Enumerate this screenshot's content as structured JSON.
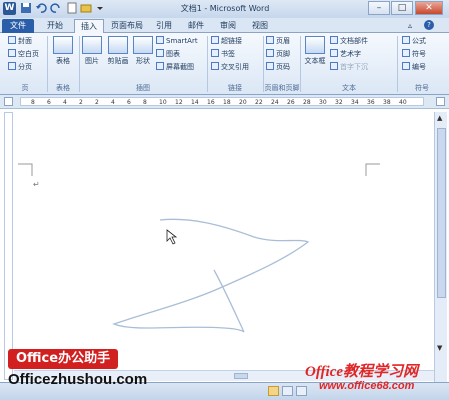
{
  "window": {
    "title": "文档1 - Microsoft Word",
    "app_icon": "W",
    "minimize": "–",
    "maximize": "□",
    "close": "✕"
  },
  "tabs": [
    {
      "label": "文件"
    },
    {
      "label": "开始"
    },
    {
      "label": "插入"
    },
    {
      "label": "页面布局"
    },
    {
      "label": "引用"
    },
    {
      "label": "邮件"
    },
    {
      "label": "审阅"
    },
    {
      "label": "视图"
    }
  ],
  "ribbon": {
    "pages": {
      "items": [
        "封面",
        "空白页",
        "分页"
      ],
      "label": "页"
    },
    "table": {
      "button": "表格",
      "label": "表格"
    },
    "illustrations": {
      "buttons": [
        "图片",
        "剪贴画",
        "形状"
      ],
      "items": [
        "SmartArt",
        "图表",
        "屏幕截图"
      ],
      "label": "插图"
    },
    "links": {
      "items": [
        "超链接",
        "书签",
        "交叉引用"
      ],
      "label": "链接"
    },
    "header_footer": {
      "items": [
        "页眉",
        "页脚",
        "页码"
      ],
      "label": "页眉和页脚"
    },
    "text": {
      "button": "文本框",
      "items": [
        "文档部件",
        "艺术字",
        "首字下沉"
      ],
      "label": "文本"
    },
    "symbols": {
      "items": [
        "公式",
        "符号",
        "编号"
      ],
      "label": "符号"
    }
  },
  "ruler": {
    "ticks": [
      "8",
      "6",
      "4",
      "2",
      "2",
      "4",
      "6",
      "8",
      "10",
      "12",
      "14",
      "16",
      "18",
      "20",
      "22",
      "24",
      "26",
      "28",
      "30",
      "32",
      "34",
      "36",
      "38",
      "40"
    ]
  },
  "document": {
    "paragraph_mark": "↵"
  },
  "watermarks": {
    "left_badge": "Office办公助手",
    "left_url": "Officezhushou.com",
    "right_title": "Office教程学习网",
    "right_url": "www.office68.com"
  },
  "colors": {
    "accent": "#2a5ea8",
    "stroke": "#a9bed6",
    "watermark_red": "#e12626"
  }
}
